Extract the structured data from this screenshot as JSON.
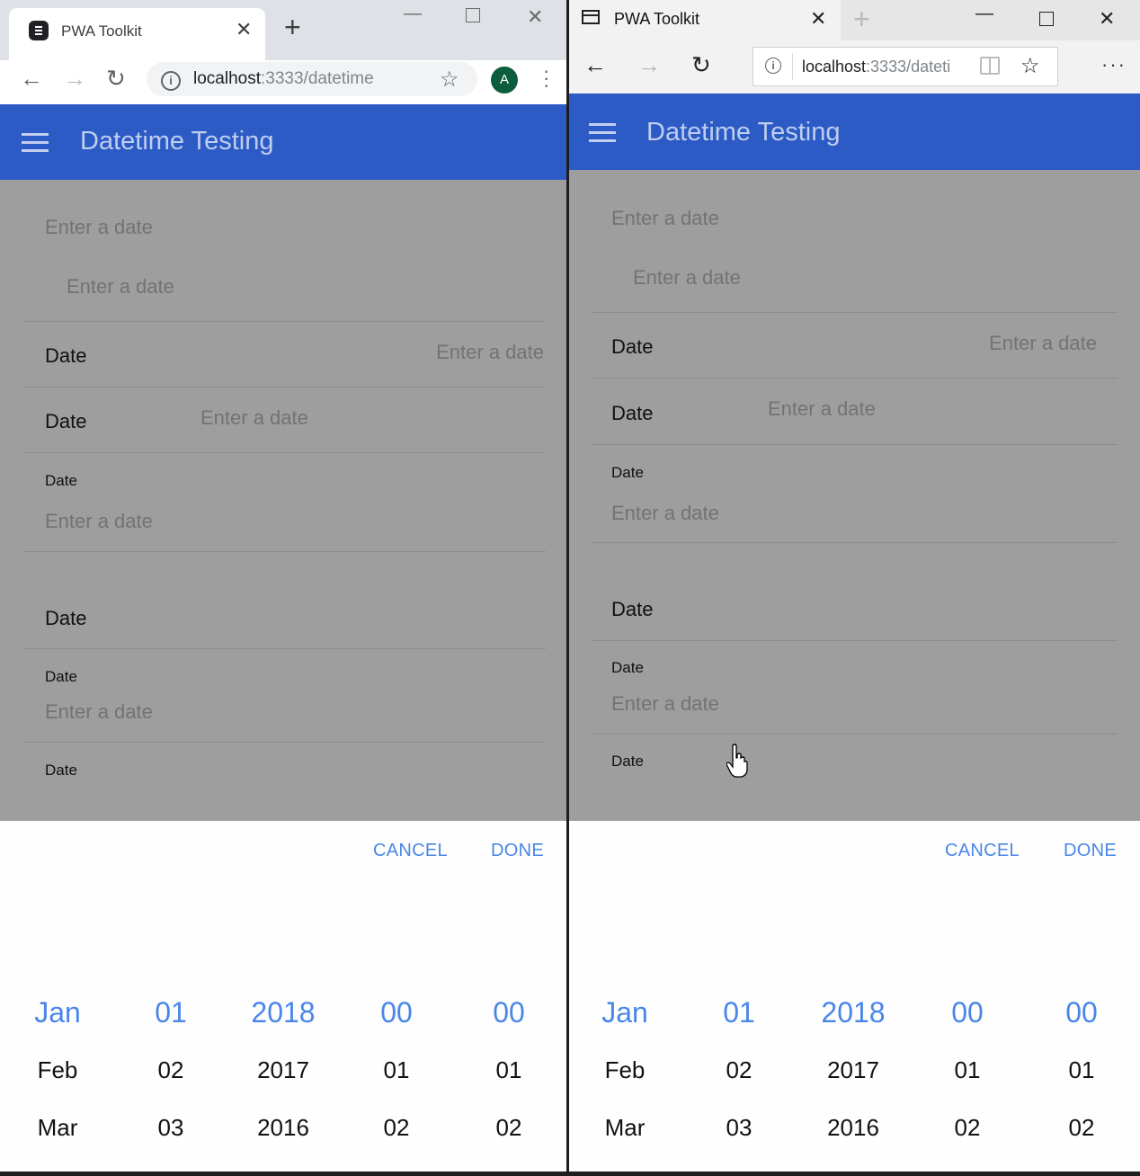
{
  "left_browser": {
    "tab_title": "PWA Toolkit",
    "url_host": "localhost",
    "url_path": ":3333/datetime",
    "avatar_letter": "A"
  },
  "right_browser": {
    "tab_title": "PWA Toolkit",
    "url_host": "localhost",
    "url_path": ":3333/dateti"
  },
  "app": {
    "title": "Datetime Testing",
    "placeholder": "Enter a date",
    "label": "Date",
    "picker": {
      "cancel": "CANCEL",
      "done": "DONE",
      "columns": [
        {
          "selected": "Jan",
          "options": [
            "Feb",
            "Mar"
          ]
        },
        {
          "selected": "01",
          "options": [
            "02",
            "03"
          ]
        },
        {
          "selected": "2018",
          "options": [
            "2017",
            "2016"
          ]
        },
        {
          "selected": "00",
          "options": [
            "01",
            "02"
          ]
        },
        {
          "selected": "00",
          "options": [
            "01",
            "02"
          ]
        }
      ]
    }
  },
  "colors": {
    "appbar": "#2c5bc6",
    "accent": "#4a86e8",
    "overlay": "#9e9e9e"
  },
  "icons": [
    "menu-icon",
    "back-icon",
    "forward-icon",
    "reload-icon",
    "info-icon",
    "star-icon",
    "close-icon",
    "minimize-icon",
    "maximize-icon",
    "new-tab-icon",
    "reader-icon",
    "more-icon",
    "kebab-icon"
  ]
}
